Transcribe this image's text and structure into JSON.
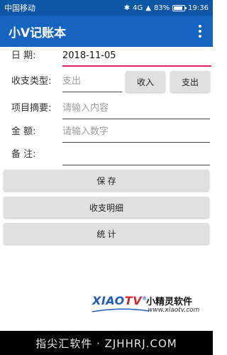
{
  "status_bar": {
    "carrier": "中国移动",
    "signal": "4G",
    "battery_percent": "83%",
    "battery_level": 0.83,
    "time": "19:36"
  },
  "app_bar": {
    "title": "小V记账本",
    "menu_icon": "more-vert-icon"
  },
  "form": {
    "date": {
      "label": "日  期:",
      "value": "2018-11-05"
    },
    "type": {
      "label": "收支类型:",
      "placeholder": "支出",
      "income_button": "收入",
      "expense_button": "支出"
    },
    "summary": {
      "label": "项目摘要:",
      "placeholder": "请输入内容"
    },
    "amount": {
      "label": "金  额:",
      "placeholder": "请输入数字"
    },
    "note": {
      "label": "备  注:",
      "placeholder": ""
    }
  },
  "actions": {
    "save": "保  存",
    "details": "收支明细",
    "stats": "统  计"
  },
  "brand": {
    "name_en_a": "XIAO",
    "name_en_b": "TV",
    "registered": "®",
    "name_cn": "小精灵软件",
    "url": "www.xiaotv.com"
  },
  "nav_bar": {
    "watermark": "指尖汇软件 · ZJHHRJ.COM"
  },
  "colors": {
    "status_bar": "#0e56a8",
    "app_bar": "#1565c0",
    "focus_underline": "#e91e63",
    "button_bg": "#e0e0e0"
  }
}
